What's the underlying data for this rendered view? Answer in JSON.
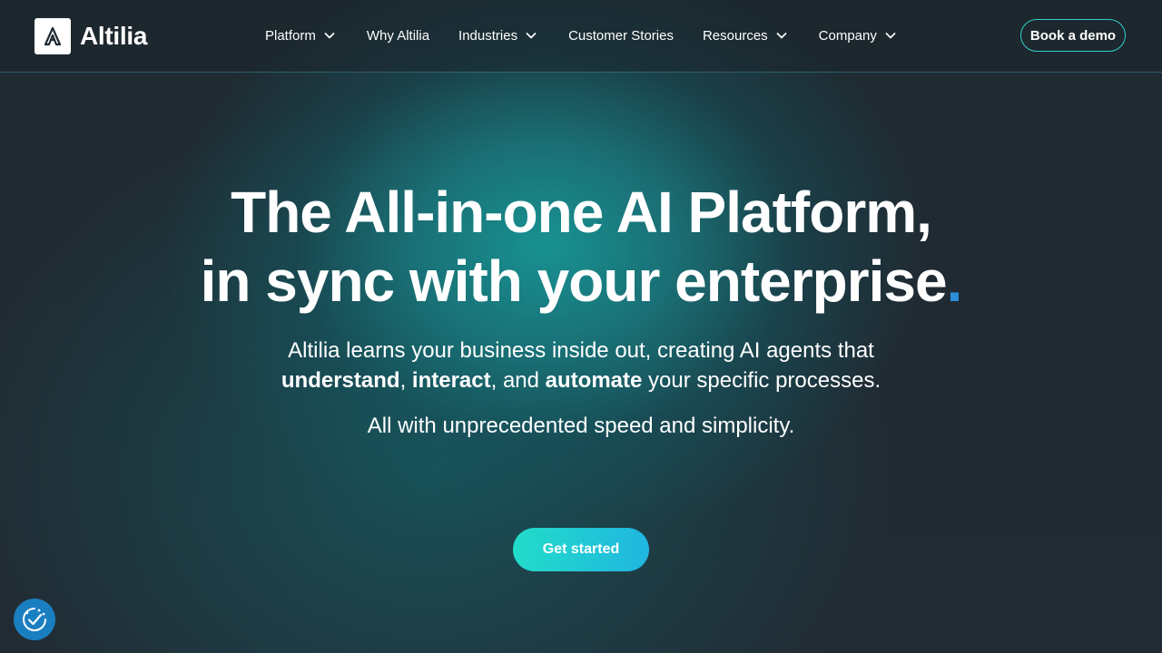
{
  "brand": {
    "name": "Altilia",
    "logo_icon": "altilia-a-icon"
  },
  "nav": {
    "items": [
      {
        "label": "Platform",
        "has_dropdown": true
      },
      {
        "label": "Why Altilia",
        "has_dropdown": false
      },
      {
        "label": "Industries",
        "has_dropdown": true
      },
      {
        "label": "Customer Stories",
        "has_dropdown": false
      },
      {
        "label": "Resources",
        "has_dropdown": true
      },
      {
        "label": "Company",
        "has_dropdown": true
      }
    ],
    "cta_label": "Book a demo"
  },
  "hero": {
    "title_line1": "The All-in-one AI Platform,",
    "title_line2": "in sync with your enterprise",
    "title_dot": ".",
    "subtitle_part1": "Altilia learns your business inside out, creating AI agents that",
    "subtitle_bold1": "understand",
    "subtitle_sep1": ", ",
    "subtitle_bold2": "interact",
    "subtitle_sep2": ", and ",
    "subtitle_bold3": "automate",
    "subtitle_part2": " your specific processes.",
    "subtitle2": "All with unprecedented speed and simplicity.",
    "cta_label": "Get started"
  },
  "cookie_widget": {
    "icon": "cookie-consent-icon"
  },
  "colors": {
    "accent_teal": "#2fd1c8",
    "accent_blue": "#2a8fd8",
    "background": "#222a33",
    "cta_gradient_start": "#22dcc9",
    "cta_gradient_end": "#1fb6e0"
  }
}
